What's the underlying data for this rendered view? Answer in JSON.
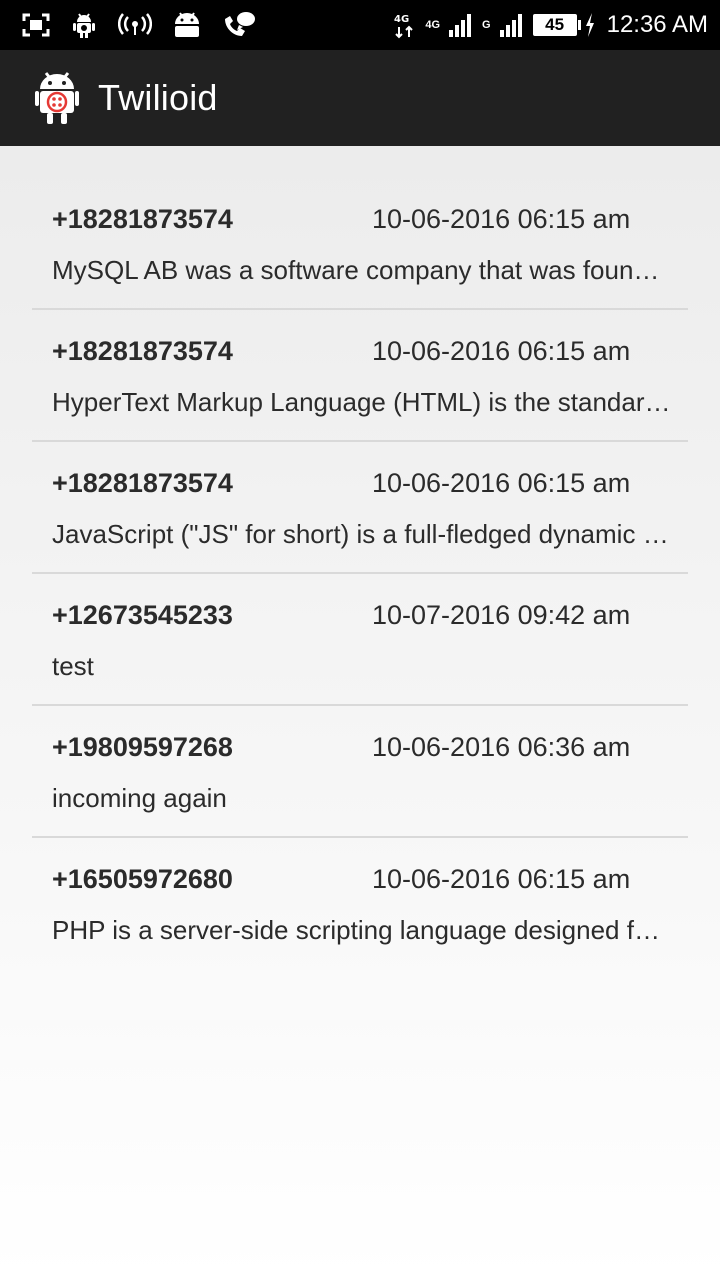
{
  "status_bar": {
    "battery_level": "45",
    "network_label_1": "4G",
    "network_label_2": "G",
    "time": "12:36 AM",
    "icons": [
      "screenshot-icon",
      "android-debug-icon",
      "wifi-hotspot-icon",
      "android-icon",
      "voice-chat-icon",
      "data-transfer-icon",
      "signal-icon",
      "battery-icon",
      "charging-icon"
    ]
  },
  "app_bar": {
    "title": "Twilioid",
    "logo": "twilioid-android-logo"
  },
  "messages": [
    {
      "phone": "+18281873574",
      "time": "10-06-2016 06:15 am",
      "preview": "MySQL AB was a software company that was founded in Sweden"
    },
    {
      "phone": "+18281873574",
      "time": "10-06-2016 06:15 am",
      "preview": "HyperText Markup Language (HTML) is the standard markup language"
    },
    {
      "phone": "+18281873574",
      "time": "10-06-2016 06:15 am",
      "preview": "JavaScript (\"JS\" for short) is a full-fledged dynamic programming language"
    },
    {
      "phone": "+12673545233",
      "time": "10-07-2016 09:42 am",
      "preview": "test"
    },
    {
      "phone": "+19809597268",
      "time": "10-06-2016 06:36 am",
      "preview": "incoming again"
    },
    {
      "phone": "+16505972680",
      "time": "10-06-2016 06:15 am",
      "preview": "PHP is a server-side scripting language designed for web development"
    }
  ],
  "colors": {
    "status_bar": "#000000",
    "app_bar": "#212121",
    "text": "#2b2b2b",
    "divider": "#d9d9d9"
  }
}
